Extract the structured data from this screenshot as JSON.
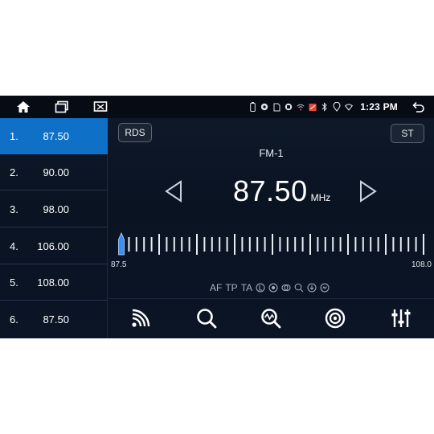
{
  "status_bar": {
    "time": "1:23 PM",
    "left_icons": [
      "home-icon",
      "recent-apps-icon",
      "screen-mirror-icon"
    ],
    "right_icons": [
      "battery-icon",
      "record-icon",
      "sim-icon",
      "cast-icon",
      "wifi-signal-icon",
      "gps-icon",
      "bluetooth-icon",
      "location-icon",
      "wifi-icon"
    ]
  },
  "presets": [
    {
      "num": "1.",
      "freq": "87.50",
      "active": true
    },
    {
      "num": "2.",
      "freq": "90.00",
      "active": false
    },
    {
      "num": "3.",
      "freq": "98.00",
      "active": false
    },
    {
      "num": "4.",
      "freq": "106.00",
      "active": false
    },
    {
      "num": "5.",
      "freq": "108.00",
      "active": false
    },
    {
      "num": "6.",
      "freq": "87.50",
      "active": false
    }
  ],
  "tuner": {
    "rds_label": "RDS",
    "st_label": "ST",
    "band": "FM-1",
    "frequency": "87.50",
    "unit": "MHz",
    "scale_min": "87.5",
    "scale_max": "108.0",
    "scale_min_value": 87.5,
    "scale_max_value": 108.0,
    "current_value": 87.5
  },
  "features": {
    "af": "AF",
    "tp": "TP",
    "ta": "TA"
  },
  "toolbar": [
    "broadcast-icon",
    "search-icon",
    "scan-icon",
    "radio-icon",
    "equalizer-icon"
  ],
  "colors": {
    "accent": "#0f70c8",
    "background": "#0b1526",
    "needle": "#3a8ff0"
  }
}
